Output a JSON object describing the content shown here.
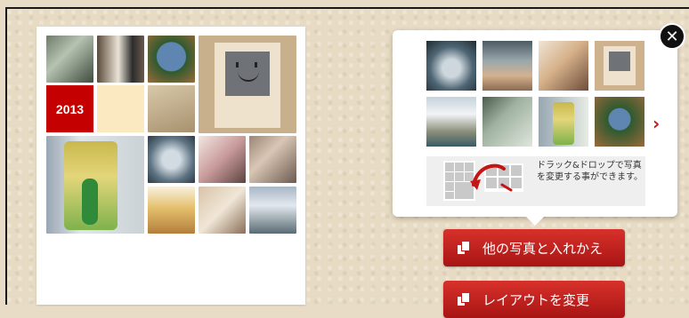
{
  "collage": {
    "year_tile": "2013"
  },
  "popup": {
    "close_label": "✕",
    "next_label": "›",
    "hint_text": "ドラック&ドロップで写真を変更する事ができます。"
  },
  "buttons": {
    "replace_label": "他の写真と入れかえ",
    "layout_label": "レイアウトを変更"
  },
  "colors": {
    "accent_red": "#c40000",
    "button_top": "#d8312b",
    "button_bottom": "#a81514"
  }
}
